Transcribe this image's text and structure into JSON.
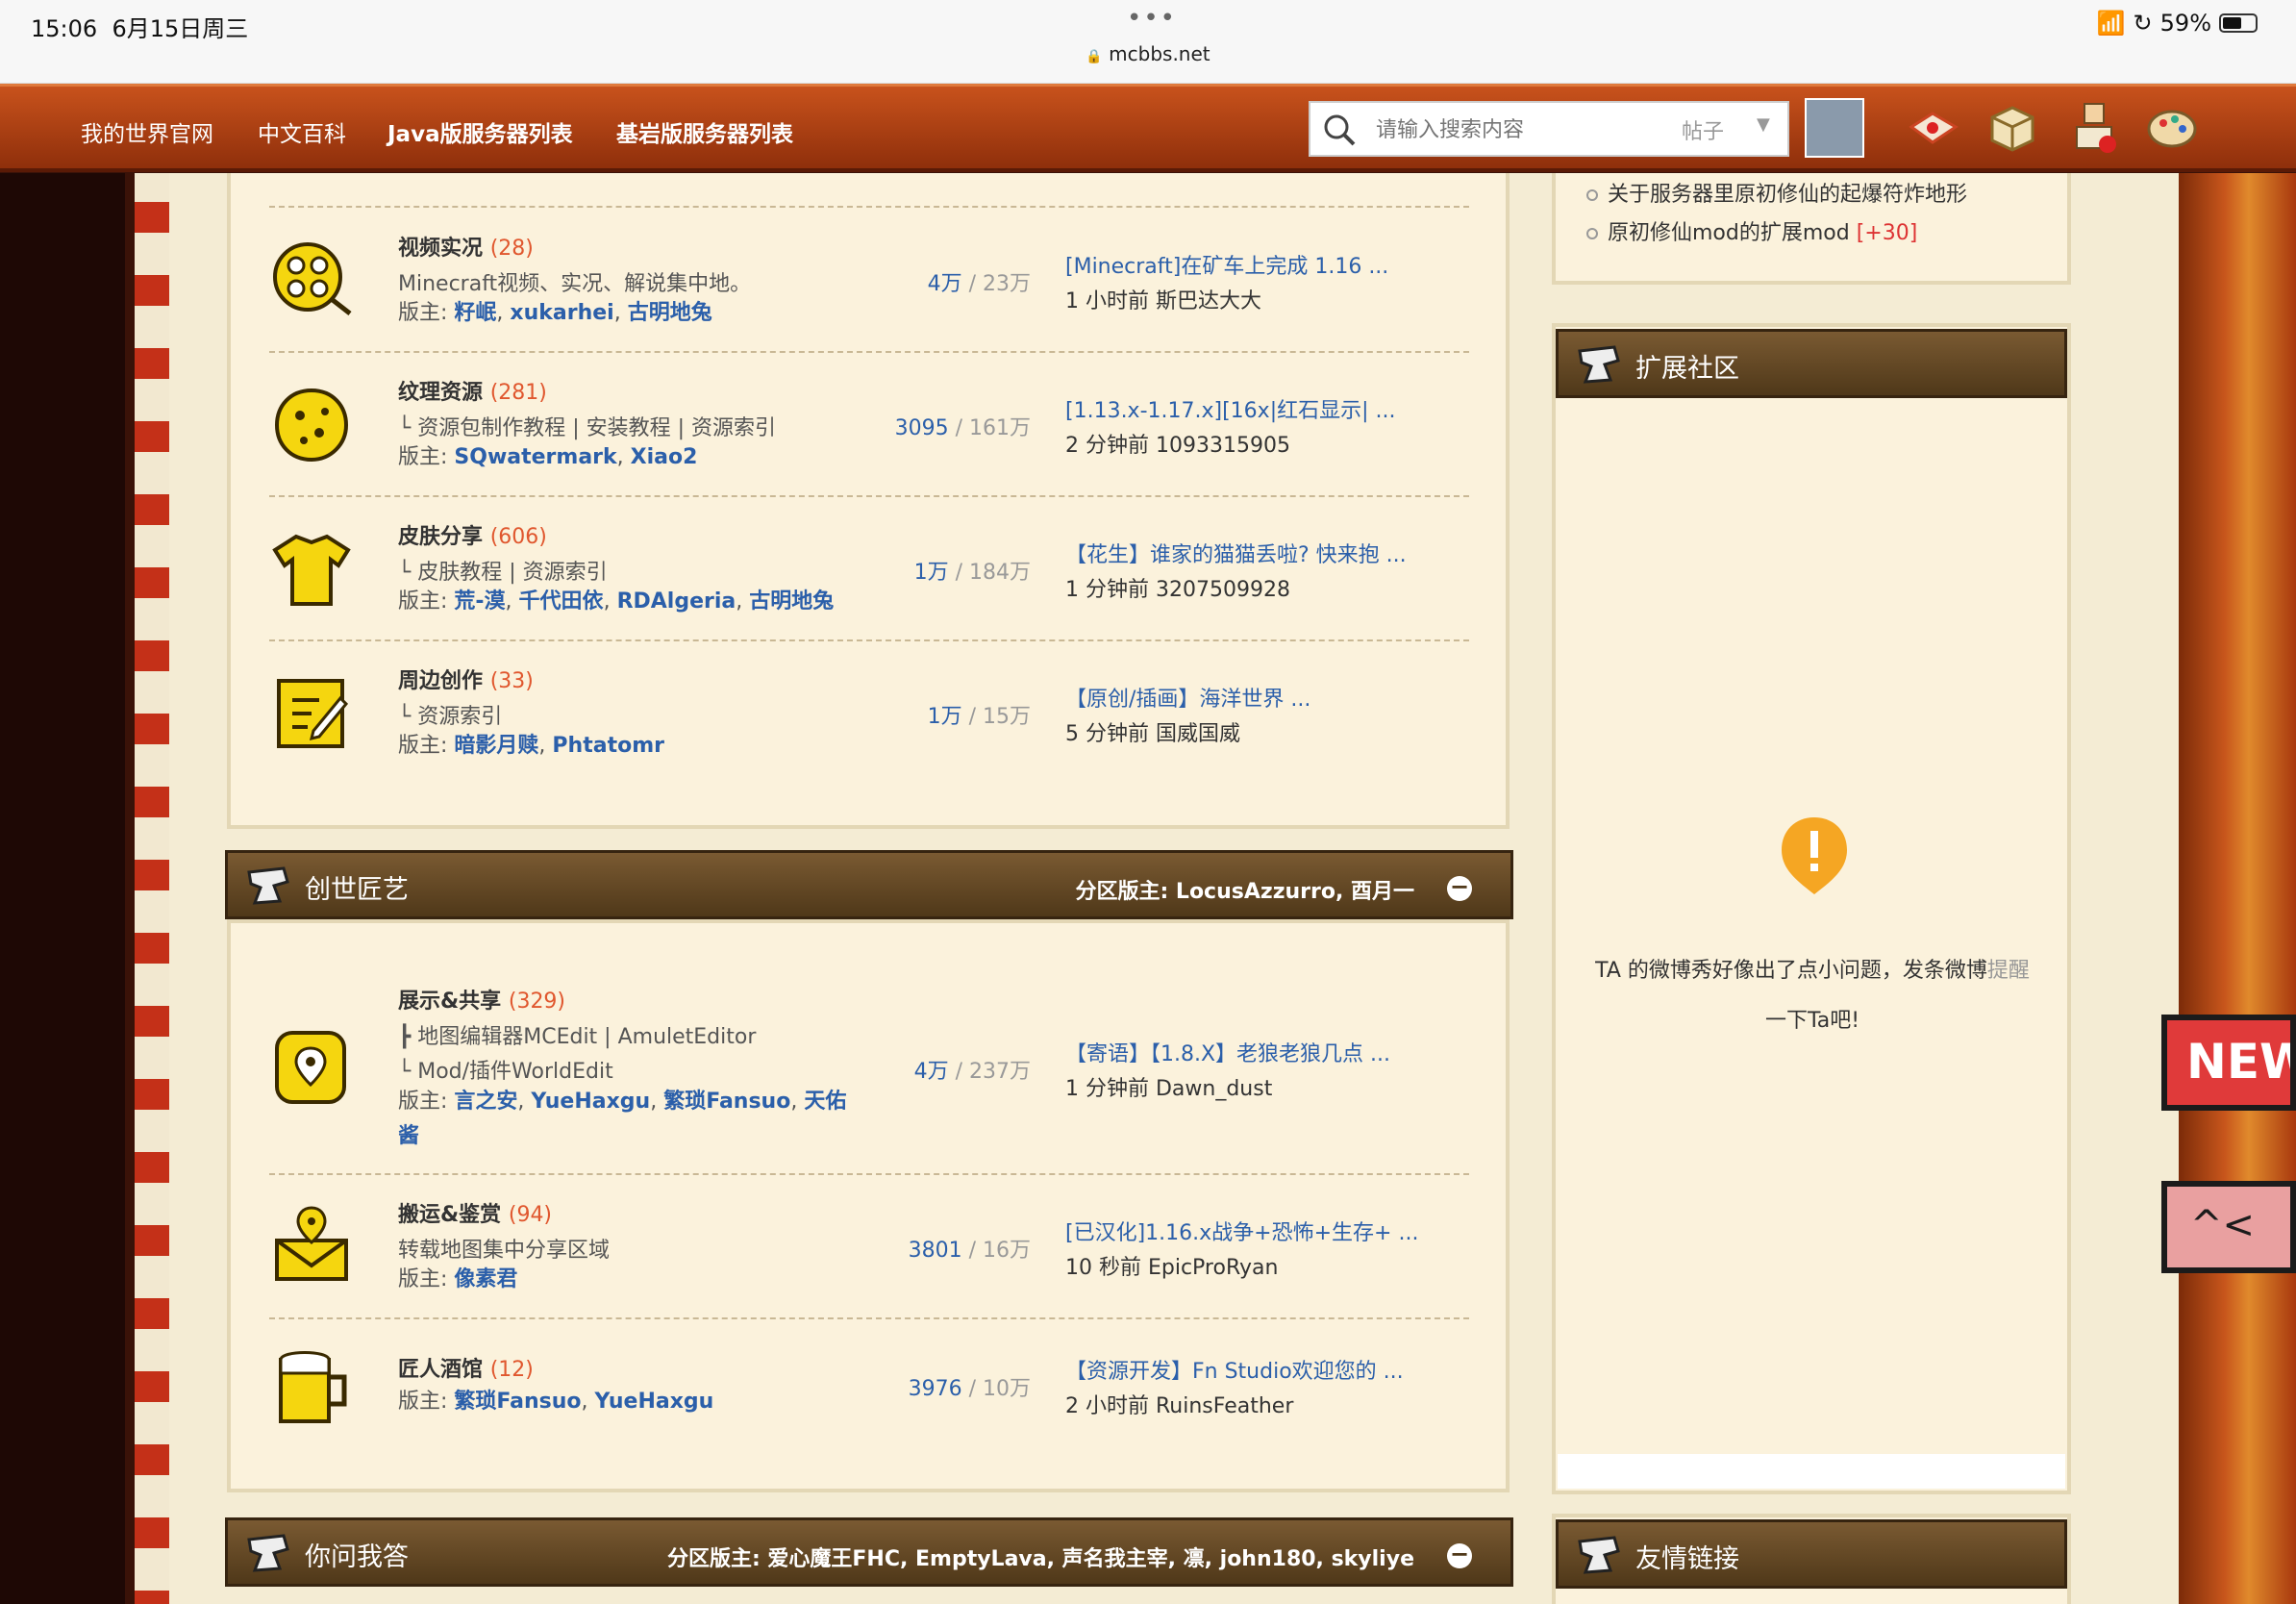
{
  "status_bar": {
    "time": "15:06",
    "date": "6月15日周三",
    "url": "mcbbs.net",
    "battery": "59%",
    "dots": "•••"
  },
  "nav": {
    "links": [
      "我的世界官网",
      "中文百科",
      "Java版服务器列表",
      "基岩版服务器列表"
    ],
    "search_placeholder": "请输入搜索内容",
    "search_type": "帖子"
  },
  "colors": {
    "nav": "#b5451a",
    "link": "#2b5faa",
    "count": "#e0572e",
    "header": "#5e4324",
    "panel": "#fbf2dc"
  },
  "sections": [
    {
      "forums": [
        {
          "icon": "film-reel-icon",
          "name": "视频实况",
          "count": "(28)",
          "desc": [
            "Minecraft视频、实况、解说集中地。"
          ],
          "mods_label": "版主: ",
          "mods": [
            "籽岷",
            "xukarhei",
            "古明地兔"
          ],
          "stats_main": "4万",
          "stats_sub": " / 23万",
          "last_title": "[Minecraft]在矿车上完成 1.16 ...",
          "last_meta": "1 小时前 斯巴达大大"
        },
        {
          "icon": "cookie-icon",
          "name": "纹理资源",
          "count": "(281)",
          "desc": [
            "└ 资源包制作教程 | 安装教程 | 资源索引"
          ],
          "mods_label": "版主: ",
          "mods": [
            "SQwatermark",
            "Xiao2"
          ],
          "stats_main": "3095",
          "stats_sub": " / 161万",
          "last_title": "[1.13.x-1.17.x][16x|红石显示| ...",
          "last_meta": "2 分钟前 1093315905"
        },
        {
          "icon": "shirt-icon",
          "name": "皮肤分享",
          "count": "(606)",
          "desc": [
            "└ 皮肤教程 | 资源索引"
          ],
          "mods_label": "版主: ",
          "mods": [
            "荒-漠",
            "千代田依",
            "RDAlgeria",
            "古明地兔"
          ],
          "stats_main": "1万",
          "stats_sub": " / 184万",
          "last_title": "【花生】谁家的猫猫丢啦? 快来抱 ...",
          "last_meta": "1 分钟前 3207509928"
        },
        {
          "icon": "pencil-note-icon",
          "name": "周边创作",
          "count": "(33)",
          "desc": [
            "└ 资源索引"
          ],
          "mods_label": "版主: ",
          "mods": [
            "暗影月赎",
            "Phtatomr"
          ],
          "stats_main": "1万",
          "stats_sub": " / 15万",
          "last_title": "【原创/插画】海洋世界 ...",
          "last_meta": "5 分钟前 国威国威"
        }
      ]
    },
    {
      "title": "创世匠艺",
      "mods_text": "分区版主: LocusAzzurro, 酉月一",
      "forums": [
        {
          "icon": "map-pin-icon",
          "name": "展示&共享",
          "count": "(329)",
          "desc": [
            "┣ 地图编辑器MCEdit | AmuletEditor",
            "└ Mod/插件WorldEdit"
          ],
          "mods_label": "版主: ",
          "mods": [
            "言之安",
            "YueHaxgu",
            "繁琐Fansuo",
            "天佑酱"
          ],
          "stats_main": "4万",
          "stats_sub": " / 237万",
          "last_title": "【寄语】【1.8.X】老狼老狼几点 ...",
          "last_meta": "1 分钟前 Dawn_dust"
        },
        {
          "icon": "envelope-pin-icon",
          "name": "搬运&鉴赏",
          "count": "(94)",
          "desc": [
            "转载地图集中分享区域"
          ],
          "mods_label": "版主: ",
          "mods": [
            "像素君"
          ],
          "stats_main": "3801",
          "stats_sub": " / 16万",
          "last_title": "[已汉化]1.16.x战争+恐怖+生存+ ...",
          "last_meta": "10 秒前 EpicProRyan"
        },
        {
          "icon": "mug-icon",
          "name": "匠人酒馆",
          "count": "(12)",
          "desc": [],
          "mods_label": "版主: ",
          "mods": [
            "繁琐Fansuo",
            "YueHaxgu"
          ],
          "stats_main": "3976",
          "stats_sub": " / 10万",
          "last_title": "【资源开发】Fn Studio欢迎您的 ...",
          "last_meta": "2 小时前 RuinsFeather"
        }
      ]
    },
    {
      "title": "你问我答",
      "mods_text": "分区版主: 爱心魔王FHC, EmptyLava, 声名我主宰, 凛, john180, skyliye",
      "forums": []
    }
  ],
  "sidebar": {
    "recent": [
      {
        "text": "关于服务器里原初修仙的起爆符炸地形",
        "extra": ""
      },
      {
        "text": "原初修仙mod的扩展mod ",
        "extra": "[+30]"
      }
    ],
    "ext_title": "扩展社区",
    "weibo_error_a": "TA 的微博秀好像出了点小问题，发条微博",
    "weibo_link": "提醒",
    "weibo_error_b": "一下Ta吧!",
    "links_title": "友情链接"
  },
  "side_buttons": {
    "new_label": "NEW",
    "share_label": "^<"
  }
}
